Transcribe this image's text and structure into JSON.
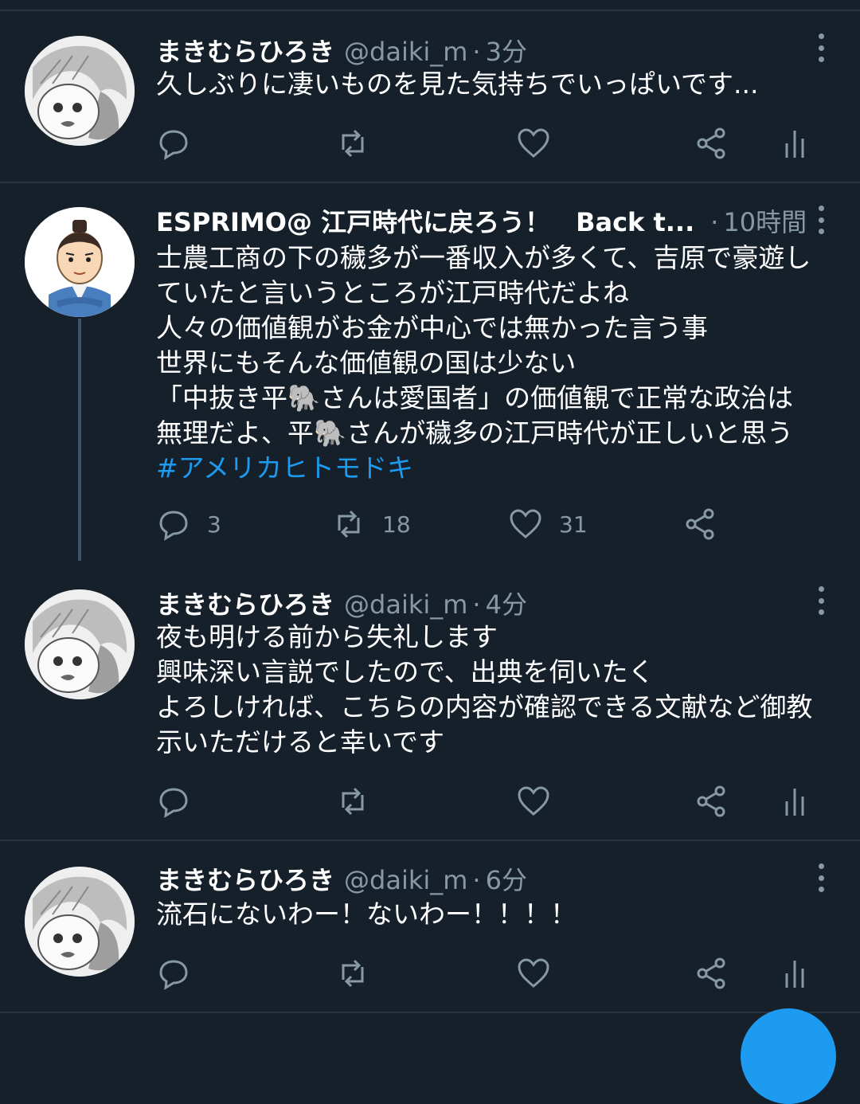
{
  "tweets": [
    {
      "name": "まきむらひろき",
      "handle": "@daiki_m",
      "time": "3分",
      "lines": [
        "久しぶりに凄いものを見た気持ちでいっぱいです..."
      ],
      "reply": "",
      "retweet": "",
      "like": ""
    },
    {
      "name": "ESPRIMO@ 江戸時代に戻ろう！　Back t...",
      "handle": "",
      "time": "10時間",
      "lines": [
        "士農工商の下の穢多が一番収入が多くて、吉原で豪遊し",
        "ていたと言いうところが江戸時代だよね",
        "人々の価値観がお金が中心では無かった言う事",
        "世界にもそんな価値観の国は少ない",
        "「中抜き平🐘さんは愛国者」の価値観で正常な政治は",
        "無理だよ、平🐘さんが穢多の江戸時代が正しいと思う"
      ],
      "hashtag": "#アメリカヒトモドキ",
      "reply": "3",
      "retweet": "18",
      "like": "31"
    },
    {
      "name": "まきむらひろき",
      "handle": "@daiki_m",
      "time": "4分",
      "lines": [
        "夜も明ける前から失礼します",
        "興味深い言説でしたので、出典を伺いたく",
        "よろしければ、こちらの内容が確認できる文献など御教",
        "示いただけると幸いです"
      ],
      "reply": "",
      "retweet": "",
      "like": ""
    },
    {
      "name": "まきむらひろき",
      "handle": "@daiki_m",
      "time": "6分",
      "lines": [
        "流石にないわー！ないわー！！！！"
      ],
      "reply": "",
      "retweet": "",
      "like": ""
    }
  ],
  "colors": {
    "background": "#15202b",
    "secondary_text": "#8899a6",
    "accent": "#1d9bf0"
  },
  "icons": [
    "reply-icon",
    "retweet-icon",
    "like-icon",
    "share-icon",
    "analytics-icon",
    "more-icon"
  ]
}
